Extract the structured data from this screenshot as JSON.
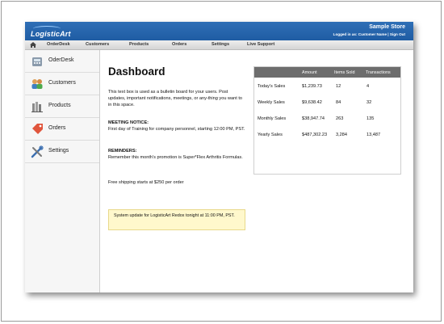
{
  "header": {
    "logo": "LogisticArt",
    "store_name": "Sample Store",
    "user_line": "Logged in as: Customer Name | Sign Out"
  },
  "nav": {
    "items": [
      "OrderDesk",
      "Customers",
      "Products",
      "Orders",
      "Settings",
      "Live Support"
    ]
  },
  "sidebar": {
    "items": [
      {
        "label": "OderDesk",
        "icon": "register-icon"
      },
      {
        "label": "Customers",
        "icon": "people-icon"
      },
      {
        "label": "Products",
        "icon": "boxes-icon"
      },
      {
        "label": "Orders",
        "icon": "tag-icon"
      },
      {
        "label": "Settings",
        "icon": "tools-icon"
      }
    ]
  },
  "main": {
    "title": "Dashboard",
    "intro": "This text box is used as a bulletin board for your users. Post updates, important notifications, meetings, or any-thing you want to in this space.",
    "meeting_heading": "MEETING NOTICE:",
    "meeting_text": "First day of Training for company personnel, starting 12:00 PM, PST.",
    "reminders_heading": "REMINDERS:",
    "reminders_text": "Remember this month's promotion is Super*Flex Arthritis Formulas.",
    "shipping_text": "Free shipping starts at $250 per order",
    "notice": "System update for LogisticArt Redox tonight at 11:00 PM, PST."
  },
  "stats": {
    "headers": [
      "",
      "Amount",
      "Items Sold",
      "Transactions"
    ],
    "rows": [
      [
        "Today's Sales",
        "$1,239.73",
        "12",
        "4"
      ],
      [
        "Weekly Sales",
        "$9,638.42",
        "84",
        "32"
      ],
      [
        "Monthly Sales",
        "$38,947.74",
        "263",
        "135"
      ],
      [
        "Yearly Sales",
        "$487,302.23",
        "3,284",
        "13,487"
      ]
    ]
  },
  "colors": {
    "header_blue": "#2a68b0",
    "table_header": "#6d6d6d",
    "notice_bg": "#fff8cc"
  }
}
